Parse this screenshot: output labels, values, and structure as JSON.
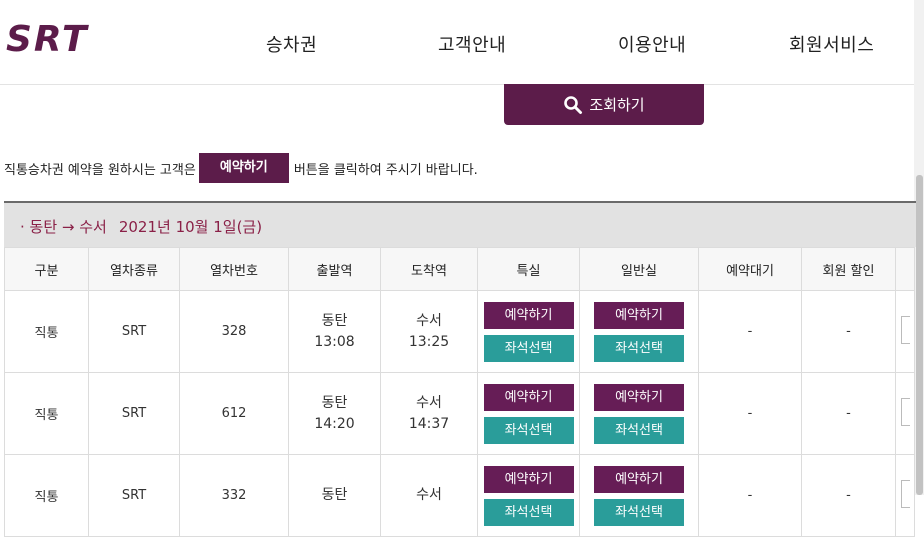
{
  "header": {
    "logo_text": "SRT",
    "nav": [
      "승차권",
      "고객안내",
      "이용안내",
      "회원서비스"
    ]
  },
  "search": {
    "label": "조회하기"
  },
  "notice": {
    "before": "직통승차권 예약을 원하시는 고객은",
    "button": "예약하기",
    "after": "버튼을 클릭하여 주시기 바랍니다."
  },
  "route": {
    "text": "· 동탄 → 수서",
    "date": "2021년 10월 1일(금)"
  },
  "table": {
    "headers": [
      "구분",
      "열차종류",
      "열차번호",
      "출발역",
      "도착역",
      "특실",
      "일반실",
      "예약대기",
      "회원 할인"
    ],
    "rows": [
      {
        "type": "직통",
        "train": "SRT",
        "number": "328",
        "dep_station": "동탄",
        "dep_time": "13:08",
        "arr_station": "수서",
        "arr_time": "13:25",
        "reserve": "예약하기",
        "seat": "좌석선택",
        "wait": "-",
        "discount": "-"
      },
      {
        "type": "직통",
        "train": "SRT",
        "number": "612",
        "dep_station": "동탄",
        "dep_time": "14:20",
        "arr_station": "수서",
        "arr_time": "14:37",
        "reserve": "예약하기",
        "seat": "좌석선택",
        "wait": "-",
        "discount": "-"
      },
      {
        "type": "직통",
        "train": "SRT",
        "number": "332",
        "dep_station": "동탄",
        "dep_time": "",
        "arr_station": "수서",
        "arr_time": "",
        "reserve": "예약하기",
        "seat": "좌석선택",
        "wait": "-",
        "discount": "-"
      }
    ]
  },
  "colors": {
    "brand": "#5c1c4a",
    "seat_button": "#2a9d9a",
    "route_text": "#8a2047"
  }
}
